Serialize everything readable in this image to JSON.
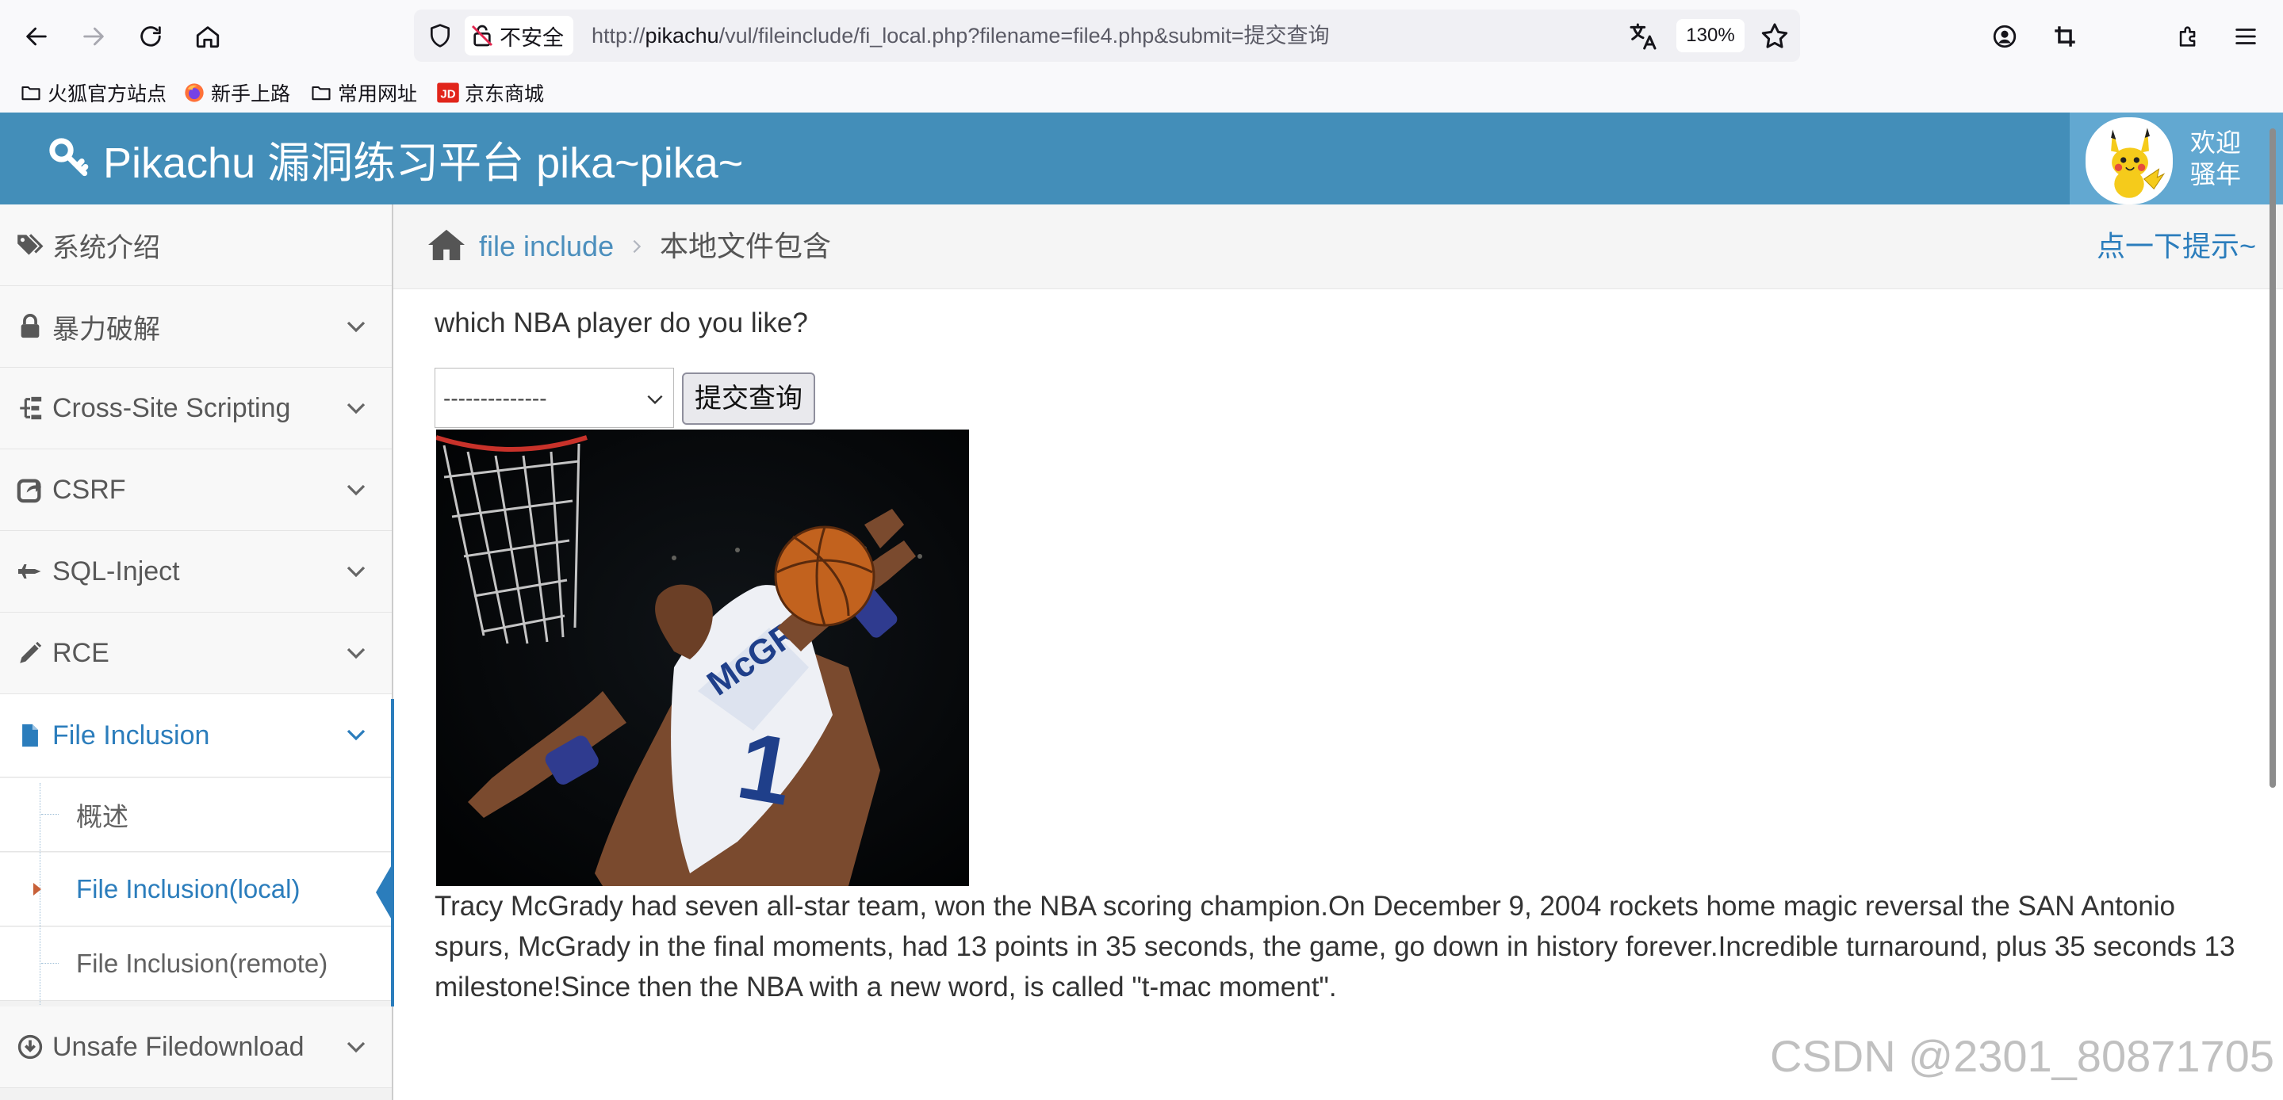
{
  "browser": {
    "security_label": "不安全",
    "url_prefix": "http://",
    "url_host": "pikachu",
    "url_path": "/vul/fileinclude/fi_local.php?filename=file4.php&submit=提交查询",
    "zoom": "130%",
    "bookmarks": [
      "火狐官方站点",
      "新手上路",
      "常用网址",
      "京东商城"
    ]
  },
  "header": {
    "brand": "Pikachu 漏洞练习平台 pika~pika~",
    "welcome_line1": "欢迎",
    "welcome_line2": "骚年"
  },
  "sidebar": {
    "items": [
      {
        "label": "系统介绍"
      },
      {
        "label": "暴力破解"
      },
      {
        "label": "Cross-Site Scripting"
      },
      {
        "label": "CSRF"
      },
      {
        "label": "SQL-Inject"
      },
      {
        "label": "RCE"
      },
      {
        "label": "File Inclusion"
      },
      {
        "label": "Unsafe Filedownload"
      }
    ],
    "subitems": [
      {
        "label": "概述"
      },
      {
        "label": "File Inclusion(local)"
      },
      {
        "label": "File Inclusion(remote)"
      }
    ]
  },
  "breadcrumb": {
    "link": "file include",
    "current": "本地文件包含",
    "hint": "点一下提示~"
  },
  "content": {
    "question": "which NBA player do you like?",
    "select_value": "--------------",
    "submit_label": "提交查询",
    "description": "Tracy McGrady had seven all-star team, won the NBA scoring champion.On December 9, 2004 rockets home magic reversal the SAN Antonio spurs, McGrady in the final moments, had 13 points in 35 seconds, the game, go down in history forever.Incredible turnaround, plus 35 seconds 13 milestone!Since then the NBA with a new word, is called \"t-mac moment\"."
  },
  "watermark": "CSDN @2301_80871705",
  "colors": {
    "navbar": "#438eb9",
    "accent": "#2b7dbc"
  }
}
